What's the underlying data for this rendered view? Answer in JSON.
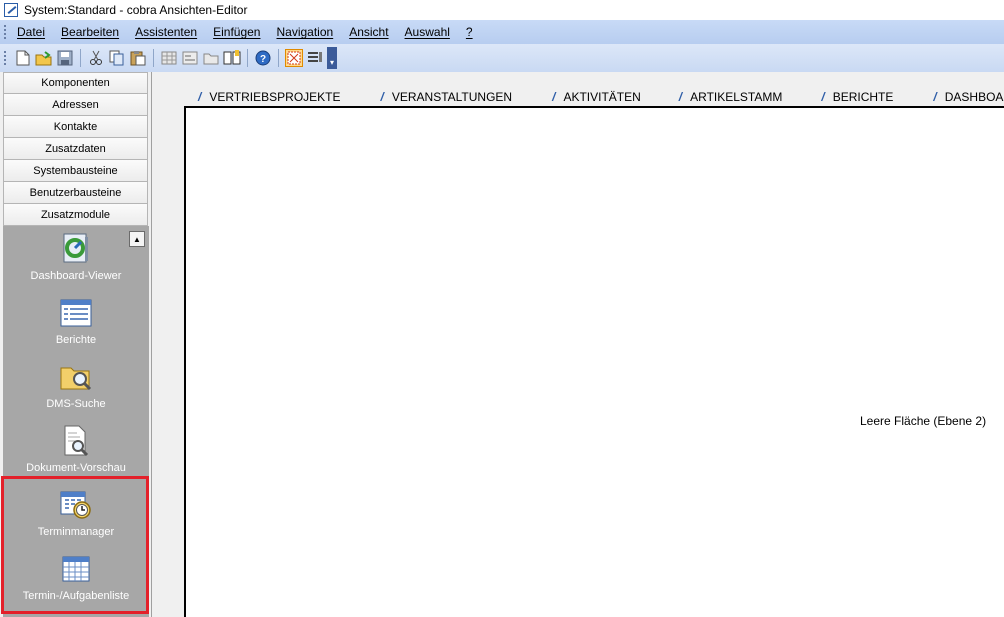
{
  "window": {
    "title": "System:Standard - cobra Ansichten-Editor"
  },
  "menu": {
    "items": [
      {
        "label": "Datei"
      },
      {
        "label": "Bearbeiten"
      },
      {
        "label": "Assistenten"
      },
      {
        "label": "Einfügen"
      },
      {
        "label": "Navigation"
      },
      {
        "label": "Ansicht"
      },
      {
        "label": "Auswahl"
      },
      {
        "label": "?"
      }
    ]
  },
  "toolbar": {
    "buttons": [
      "new-icon",
      "open-icon",
      "save-icon",
      "cut-icon",
      "copy-icon",
      "paste-icon",
      "grid-icon",
      "form-icon",
      "folder-icon",
      "book-icon",
      "help-icon",
      "select-icon",
      "list-icon"
    ]
  },
  "sidebar": {
    "headers": [
      {
        "label": "Komponenten"
      },
      {
        "label": "Adressen"
      },
      {
        "label": "Kontakte"
      },
      {
        "label": "Zusatzdaten"
      },
      {
        "label": "Systembausteine"
      },
      {
        "label": "Benutzerbausteine"
      },
      {
        "label": "Zusatzmodule"
      }
    ],
    "modules": [
      {
        "label": "Dashboard-Viewer",
        "icon": "dashboard-icon"
      },
      {
        "label": "Berichte",
        "icon": "report-icon"
      },
      {
        "label": "DMS-Suche",
        "icon": "folder-search-icon"
      },
      {
        "label": "Dokument-Vorschau",
        "icon": "document-preview-icon"
      },
      {
        "label": "Terminmanager",
        "icon": "calendar-clock-icon"
      },
      {
        "label": "Termin-/Aufgabenliste",
        "icon": "calendar-grid-icon"
      }
    ]
  },
  "tabs": [
    {
      "label": "VERTRIEBSPROJEKTE"
    },
    {
      "label": "VERANSTALTUNGEN"
    },
    {
      "label": "AKTIVITÄTEN"
    },
    {
      "label": "ARTIKELSTAMM"
    },
    {
      "label": "BERICHTE"
    },
    {
      "label": "DASHBOARDS"
    }
  ],
  "canvas": {
    "label": "Leere Fläche (Ebene 2)"
  },
  "colors": {
    "accent": "#2f5ea8",
    "highlight": "#e3202a",
    "panel": "#a7a7a7"
  }
}
